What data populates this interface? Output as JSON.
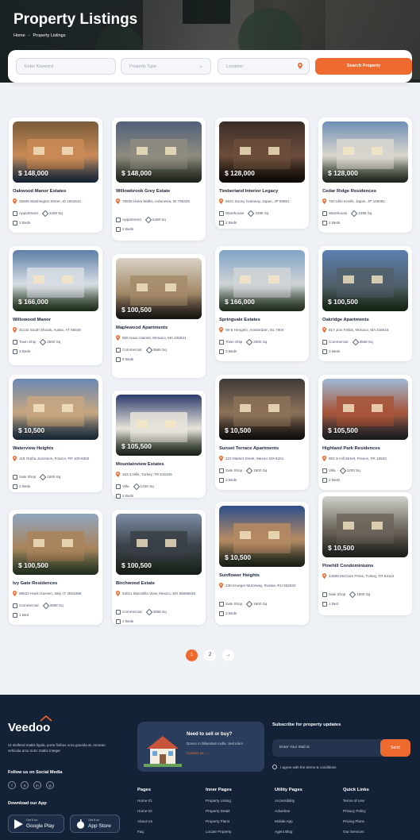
{
  "hero": {
    "title": "Property Listings",
    "breadcrumb": [
      "Home",
      "-",
      "Property Listings"
    ]
  },
  "search": {
    "keyword_placeholder": "Enter Keyword",
    "type_placeholder": "Property Type",
    "location_placeholder": "Location",
    "button_label": "Search Property"
  },
  "listings": [
    {
      "price": "$ 148,000",
      "title": "Oakwood Manor Estates",
      "address": "25945 Washington Street, ID 1651612",
      "type": "Appartment",
      "area": "2468 Sq",
      "beds": "3 Beds"
    },
    {
      "price": "$ 148,000",
      "title": "Willowbrook Grey Estate",
      "address": "75835 Hana Walks, Indonesia, ID 796325",
      "type": "Appartment",
      "area": "2468 Sq",
      "beds": "2 Beds"
    },
    {
      "price": "$ 128,000",
      "title": "Timberland Interior Legacy",
      "address": "6621 Sunny Gateway, Japan, JP 65651",
      "type": "Warehouse",
      "area": "2395 Sq",
      "beds": "2 Beds"
    },
    {
      "price": "$ 128,000",
      "title": "Cedar Ridge Residences",
      "address": "760 Idris Knolls, Japan, JP 165061",
      "type": "Warehouse",
      "area": "2395 Sq",
      "beds": "2 Beds"
    },
    {
      "price": "$ 166,000",
      "title": "Willowood Manor",
      "address": "31142 South Shoals, Austin, AT 66546",
      "type": "Town Ship",
      "area": "2500 Sq",
      "beds": "3 Beds"
    },
    {
      "price": "$ 100,500",
      "title": "Maplewood Apartments",
      "address": "555 Isaac Islands, Monaco, MA 235531",
      "type": "Commercial",
      "area": "3568 Sq",
      "beds": "6 Beds"
    },
    {
      "price": "$ 166,000",
      "title": "Springvale Estates",
      "address": "09 B Hengelo, Amsterdam, NL 7604",
      "type": "Town Ship",
      "area": "2500 Sq",
      "beds": "3 Beds"
    },
    {
      "price": "$ 100,500",
      "title": "Oakridge Apartments",
      "address": "817 Joni Fields, Monaco, MA 316516",
      "type": "Commercial",
      "area": "3568 Sq",
      "beds": "3 Beds"
    },
    {
      "price": "$ 10,500",
      "title": "Waterview Heights",
      "address": "119 Orpha Junctions, France, FR 100-6500",
      "type": "Sale Shop",
      "area": "1500 Sq",
      "beds": "2 Beds"
    },
    {
      "price": "$ 105,500",
      "title": "Mountainview Estates",
      "address": "163 3 Hills, Turkey, TR 516105",
      "type": "Villa",
      "area": "1200 Sq",
      "beds": "3 Beds"
    },
    {
      "price": "$ 10,500",
      "title": "Sunset Terrace Apartments",
      "address": "222 Market Street, Mexico MX 6161",
      "type": "Sale Shop",
      "area": "1500 Sq",
      "beds": "3 Beds"
    },
    {
      "price": "$ 105,500",
      "title": "Highland Park Residences",
      "address": "902 S Hill Street, France, FR 19522",
      "type": "Villa",
      "area": "1200 Sq",
      "beds": "2 Beds"
    },
    {
      "price": "$ 100,500",
      "title": "Ivy Gate Residences",
      "address": "99532 Hank Hansen, Italy, IT 4553266",
      "type": "Commercial",
      "area": "3568 Sq",
      "beds": "1 Bed"
    },
    {
      "price": "$ 100,500",
      "title": "Birchwood Estate",
      "address": "53611 Macmillia View, Mexico, MX 55656636",
      "type": "Commercial",
      "area": "3568 Sq",
      "beds": "2 Beds"
    },
    {
      "price": "$ 10,500",
      "title": "Sunflower Heights",
      "address": "230 Krueger Motorway, Russia, RU 632632",
      "type": "Sale Shop",
      "area": "1500 Sq",
      "beds": "3 Beds"
    },
    {
      "price": "$ 10,500",
      "title": "Pinehill Condominiums",
      "address": "44599 McClure Pines, Turkey, TR 63113",
      "type": "Sale Shop",
      "area": "1500 Sq",
      "beds": "1 Bed"
    }
  ],
  "pagination": {
    "pages": [
      "1",
      "2"
    ],
    "next": "→",
    "current": "1"
  },
  "footer": {
    "logo": "Veedoo",
    "description": "Ut eleifend mattis ligula, porta finibus urna gravida at. Aenean vehicula arcu nunc mattis Integer",
    "social_heading": "Follow us on Social Media",
    "socials": [
      "f",
      "X",
      "in",
      "◎"
    ],
    "app_heading": "Download our App",
    "google_small": "Get it on",
    "google_big": "Google Play",
    "apple_small": "Get it on",
    "apple_big": "App Store",
    "cta_title": "Need to sell or buy?",
    "cta_text": "Donec in bibendum nulla. Sed idum",
    "cta_link": "Contact us →",
    "subscribe_title": "Subscribe for property updates",
    "mail_placeholder": "Enter Your Mail id",
    "send_label": "Send",
    "agree_text": "I agree with the terms & conditions",
    "columns": [
      {
        "heading": "Pages",
        "links": [
          "Home 01",
          "Home 02",
          "About Us",
          "Faq"
        ]
      },
      {
        "heading": "Inner Pages",
        "links": [
          "Property Listing",
          "Property Detail",
          "Property Plans",
          "Locate Property"
        ]
      },
      {
        "heading": "Utility Pages",
        "links": [
          "Accessibility",
          "Advertise",
          "Mobile App",
          "Agent Blog"
        ]
      },
      {
        "heading": "Quick Links",
        "links": [
          "Terms of Use",
          "Privacy Policy",
          "Pricing Plans",
          "Our Services"
        ]
      }
    ]
  },
  "colors": {
    "accent": "#ef6a2f",
    "footer_bg": "#142238",
    "page_bg": "#eef1f6"
  }
}
